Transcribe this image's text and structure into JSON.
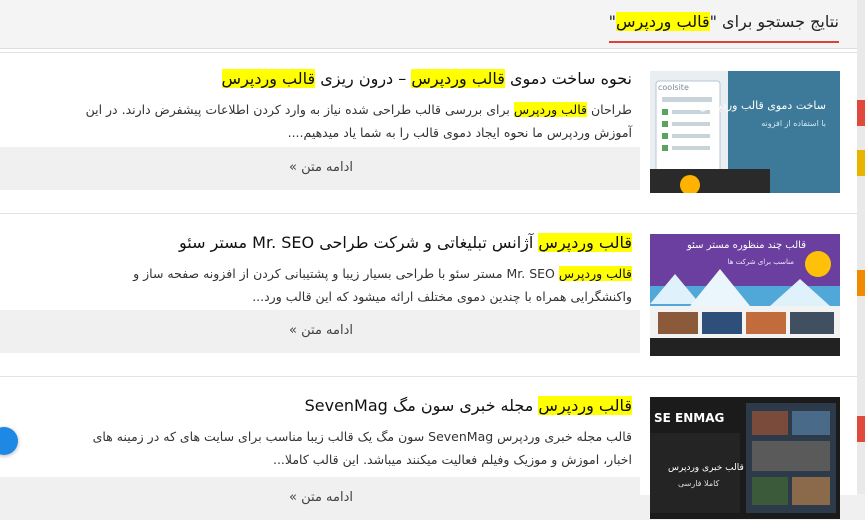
{
  "header": {
    "prefix": "نتایج جستجو برای ",
    "query": "قالب وردپرس",
    "quote": "\""
  },
  "results": [
    {
      "title_parts": [
        {
          "text": "نحوه ساخت دموی ",
          "hl": false
        },
        {
          "text": "قالب وردپرس",
          "hl": true
        },
        {
          "text": " – درون ریزی ",
          "hl": false
        },
        {
          "text": "قالب وردپرس",
          "hl": true
        }
      ],
      "excerpt_parts": [
        {
          "text": "طراحان ",
          "hl": false
        },
        {
          "text": "قالب وردپرس",
          "hl": true
        },
        {
          "text": " برای بررسی قالب طراحی شده نیاز به وارد کردن اطلاعات پیشفرض دارند. در این آموزش وردپرس ما نحوه ایجاد دموی قالب را به شما یاد میدهیم....",
          "hl": false
        }
      ],
      "read_more": "ادامه متن »",
      "thumb": {
        "caption": "ساخت دموی قالب وردپرس",
        "sub": "با استفاده از افزونه",
        "logo": "coolsite"
      }
    },
    {
      "title_parts": [
        {
          "text": "قالب وردپرس",
          "hl": true
        },
        {
          "text": " آژانس تبلیغاتی و شرکت طراحی Mr. SEO مستر سئو",
          "hl": false
        }
      ],
      "excerpt_parts": [
        {
          "text": "قالب وردپرس",
          "hl": true
        },
        {
          "text": " Mr. SEO مستر سئو با طراحی بسیار زیبا و پشتیبانی کردن از افزونه صفحه ساز و واکنشگرایی همراه با چندین دموی مختلف ارائه میشود که این قالب ورد...",
          "hl": false
        }
      ],
      "read_more": "ادامه متن »",
      "thumb": {
        "caption": "قالب چند منظوره مستر سئو",
        "sub": "مناسب برای شرکت ها",
        "logo": ""
      }
    },
    {
      "title_parts": [
        {
          "text": "قالب وردپرس",
          "hl": true
        },
        {
          "text": " مجله خبری سون مگ SevenMag",
          "hl": false
        }
      ],
      "excerpt_parts": [
        {
          "text": "قالب مجله خبری وردپرس SevenMag سون مگ یک قالب زیبا مناسب برای سایت های که در زمینه های اخبار، اموزش و موزیک وفیلم فعالیت میکنند میباشد. این قالب کاملا...",
          "hl": false
        }
      ],
      "read_more": "ادامه متن »",
      "thumb": {
        "caption": "قالب خبری وردپرس",
        "sub": "کاملا فارسی",
        "logo": "SE ENMAG"
      }
    }
  ],
  "colors": {
    "highlight": "#ffff00",
    "header_underline": "#e0403c",
    "readmore_bg": "#f0f0f0"
  }
}
